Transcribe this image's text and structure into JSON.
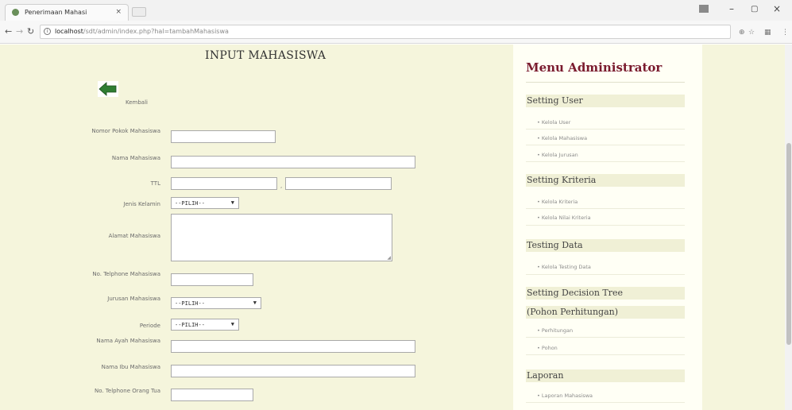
{
  "browser": {
    "tab_title": "Penerimaan Mahasi",
    "tab_close": "×",
    "url_host": "localhost",
    "url_path": "/sdt/admin/index.php?hal=tambahMahasiswa",
    "minimize": "–",
    "maximize": "▢",
    "close": "×"
  },
  "form": {
    "title": "INPUT MAHASISWA",
    "back_label": "Kembali",
    "fields": [
      {
        "label": "Nomor Pokok Mahasiswa"
      },
      {
        "label": "Nama Mahasiswa"
      },
      {
        "label": "TTL",
        "separator": ","
      },
      {
        "label": "Jenis Kelamin",
        "select": "--PILIH--"
      },
      {
        "label": "Alamat Mahasiswa"
      },
      {
        "label": "No. Telphone Mahasiswa"
      },
      {
        "label": "Jurusan Mahasiswa",
        "select": "--PILIH--"
      },
      {
        "label": "Periode",
        "select": "--PILIH--"
      },
      {
        "label": "Nama Ayah Mahasiswa"
      },
      {
        "label": "Nama Ibu Mahasiswa"
      },
      {
        "label": "No. Telphone Orang Tua"
      }
    ]
  },
  "menu": {
    "title": "Menu Administrator",
    "sections": [
      {
        "heading": "Setting User",
        "items": [
          "Kelola User",
          "Kelola Mahasiswa",
          "Kelola Jurusan"
        ]
      },
      {
        "heading": "Setting Kriteria",
        "items": [
          "Kelola Kriteria",
          "Kelola Nilai Kriteria"
        ]
      },
      {
        "heading": "Testing Data",
        "items": [
          "Kelola Testing Data"
        ]
      },
      {
        "heading": "Setting Decision Tree",
        "heading2": "(Pohon Perhitungan)",
        "items": [
          "Perhitungan",
          "Pohon"
        ]
      },
      {
        "heading": "Laporan",
        "items": [
          "Laporan Mahasiswa"
        ]
      }
    ]
  }
}
